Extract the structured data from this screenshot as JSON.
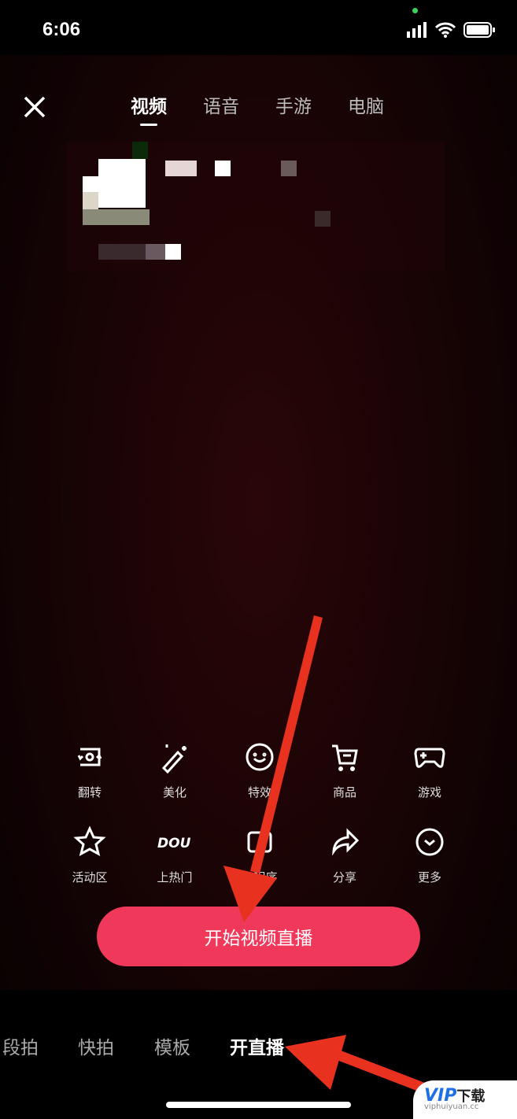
{
  "status_bar": {
    "time": "6:06"
  },
  "header": {
    "close_icon": "close-icon",
    "tabs": [
      {
        "label": "视频",
        "active": true
      },
      {
        "label": "语音"
      },
      {
        "label": "手游"
      },
      {
        "label": "电脑"
      }
    ]
  },
  "tools": [
    {
      "label": "翻转",
      "icon": "flip-camera-icon"
    },
    {
      "label": "美化",
      "icon": "magic-wand-icon"
    },
    {
      "label": "特效",
      "icon": "smiley-icon"
    },
    {
      "label": "商品",
      "icon": "cart-icon"
    },
    {
      "label": "游戏",
      "icon": "gamepad-icon"
    },
    {
      "label": "活动区",
      "icon": "star-icon"
    },
    {
      "label": "上热门",
      "icon": "dou-plus-icon"
    },
    {
      "label": "小程序",
      "icon": "mini-program-icon"
    },
    {
      "label": "分享",
      "icon": "share-icon"
    },
    {
      "label": "更多",
      "icon": "more-icon"
    }
  ],
  "start_button": "开始视频直播",
  "modes": [
    {
      "label": "段拍"
    },
    {
      "label": "快拍"
    },
    {
      "label": "模板"
    },
    {
      "label": "开直播",
      "active": true
    }
  ],
  "watermark": {
    "logo": "VIP",
    "text": "下载",
    "url": "viphuiyuan.cc"
  },
  "colors": {
    "accent": "#f0385a",
    "annotation_arrow": "#e8321f"
  }
}
